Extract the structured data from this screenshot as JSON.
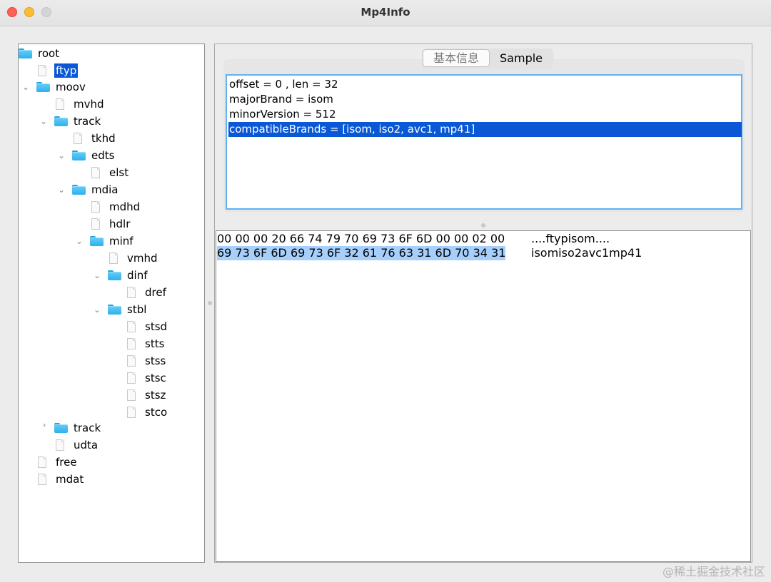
{
  "window": {
    "title": "Mp4Info"
  },
  "tree": {
    "nodes": [
      {
        "label": "root",
        "icon": "folder"
      },
      {
        "label": "ftyp",
        "icon": "file",
        "selected": true
      },
      {
        "label": "moov",
        "icon": "folder",
        "expanded": true
      },
      {
        "label": "mvhd",
        "icon": "file"
      },
      {
        "label": "track",
        "icon": "folder",
        "expanded": true
      },
      {
        "label": "tkhd",
        "icon": "file"
      },
      {
        "label": "edts",
        "icon": "folder",
        "expanded": true
      },
      {
        "label": "elst",
        "icon": "file"
      },
      {
        "label": "mdia",
        "icon": "folder",
        "expanded": true
      },
      {
        "label": "mdhd",
        "icon": "file"
      },
      {
        "label": "hdlr",
        "icon": "file"
      },
      {
        "label": "minf",
        "icon": "folder",
        "expanded": true
      },
      {
        "label": "vmhd",
        "icon": "file"
      },
      {
        "label": "dinf",
        "icon": "folder",
        "expanded": true
      },
      {
        "label": "dref",
        "icon": "file"
      },
      {
        "label": "stbl",
        "icon": "folder",
        "expanded": true
      },
      {
        "label": "stsd",
        "icon": "file"
      },
      {
        "label": "stts",
        "icon": "file"
      },
      {
        "label": "stss",
        "icon": "file"
      },
      {
        "label": "stsc",
        "icon": "file"
      },
      {
        "label": "stsz",
        "icon": "file"
      },
      {
        "label": "stco",
        "icon": "file"
      },
      {
        "label": "track",
        "icon": "folder",
        "expanded": false
      },
      {
        "label": "udta",
        "icon": "file"
      },
      {
        "label": "free",
        "icon": "file"
      },
      {
        "label": "mdat",
        "icon": "file"
      }
    ]
  },
  "tabs": [
    {
      "label": "基本信息",
      "active": true
    },
    {
      "label": "Sample",
      "active": false
    }
  ],
  "info": {
    "rows": [
      {
        "text": "offset = 0 , len = 32"
      },
      {
        "text": "majorBrand = isom"
      },
      {
        "text": "minorVersion = 512"
      },
      {
        "text": "compatibleBrands = [isom, iso2, avc1, mp41]",
        "selected": true
      }
    ]
  },
  "hex": {
    "lines": [
      {
        "hex": "00 00 00 20 66 74 79 70 69 73 6F 6D 00 00 02 00",
        "ascii": "....ftypisom....",
        "selected": false
      },
      {
        "hex": "69 73 6F 6D 69 73 6F 32 61 76 63 31 6D 70 34 31",
        "ascii": "isomiso2avc1mp41",
        "selected": true
      }
    ]
  },
  "watermark": "@稀土掘金技术社区",
  "colors": {
    "selection": "#0a58d6",
    "hex_selection": "#a6d0fb",
    "folder": "#2eb0ee"
  }
}
